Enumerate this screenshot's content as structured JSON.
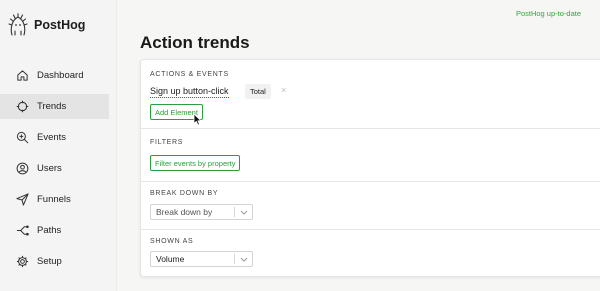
{
  "brand": {
    "name": "PostHog",
    "logo_icon": "hedgehog-icon"
  },
  "status_text": "PostHog up-to-date",
  "sidebar": {
    "items": [
      {
        "label": "Dashboard",
        "icon": "home-icon",
        "active": false
      },
      {
        "label": "Trends",
        "icon": "crosshair-icon",
        "active": true
      },
      {
        "label": "Events",
        "icon": "search-icon",
        "active": false
      },
      {
        "label": "Users",
        "icon": "users-icon",
        "active": false
      },
      {
        "label": "Funnels",
        "icon": "send-icon",
        "active": false
      },
      {
        "label": "Paths",
        "icon": "paths-icon",
        "active": false
      },
      {
        "label": "Setup",
        "icon": "gear-icon",
        "active": false
      }
    ]
  },
  "page": {
    "title": "Action trends"
  },
  "actions_events": {
    "title": "ACTIONS & EVENTS",
    "action_name": "Sign up button-click",
    "math_label": "Total",
    "remove_symbol": "×",
    "add_button": "Add Element"
  },
  "filters": {
    "title": "FILTERS",
    "button": "Filter events by property"
  },
  "breakdown": {
    "title": "BREAK DOWN BY",
    "placeholder": "Break down by"
  },
  "shown_as": {
    "title": "SHOWN AS",
    "value": "Volume"
  },
  "colors": {
    "accent_green": "#2c9e3f",
    "status_green": "#32a83a",
    "link_blue": "#1a6bd9",
    "sidebar_bg": "#f4f4f4",
    "active_bg": "#e4e4e4"
  }
}
